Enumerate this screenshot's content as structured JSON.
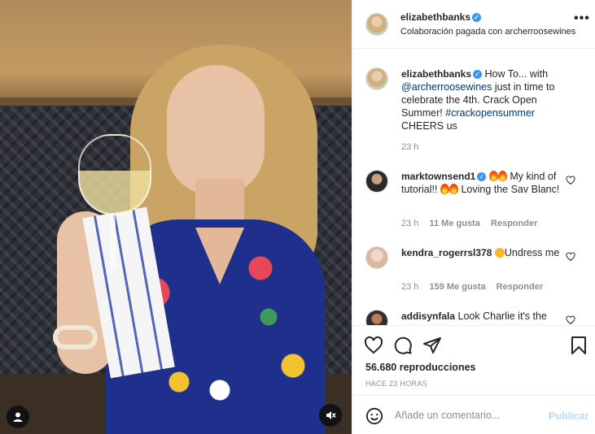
{
  "post": {
    "author": "elizabethbanks",
    "verified": true,
    "partnership_text": "Colaboración pagada con archerroosewines",
    "more_label": "•••"
  },
  "caption": {
    "username": "elizabethbanks",
    "text_before": "How To... with",
    "mention": "@archerroosewines",
    "text_mid": "just in time to celebrate the 4th. Crack Open Summer!",
    "hashtag": "#crackopensummer",
    "text_after": "CHEERS us",
    "time": "23 h"
  },
  "comments": [
    {
      "username": "marktownsend1",
      "verified": true,
      "text_a": "My kind of tutorial!!",
      "text_b": "Loving the Sav Blanc!",
      "time": "23 h",
      "likes": "11 Me gusta",
      "reply": "Responder"
    },
    {
      "username": "kendra_rogerrsl378",
      "text": "Undress me",
      "time": "23 h",
      "likes": "159 Me gusta",
      "reply": "Responder"
    },
    {
      "username": "addisynfala",
      "text": "Look Charlie it's the"
    }
  ],
  "stats": {
    "views": "56.680 reproducciones",
    "posted": "HACE 23 HORAS"
  },
  "composer": {
    "placeholder": "Añade un comentario...",
    "publish_label": "Publicar"
  },
  "icons": {
    "like": "heart-icon",
    "comment": "comment-icon",
    "share": "send-icon",
    "save": "bookmark-icon",
    "tag": "user-tag-icon",
    "mute": "muted-speaker-icon",
    "emoji": "emoji-icon"
  },
  "colors": {
    "link": "#00376b",
    "verified": "#3897f0",
    "secondary_text": "#8e8e8e",
    "publish_disabled": "#b2dffc"
  }
}
